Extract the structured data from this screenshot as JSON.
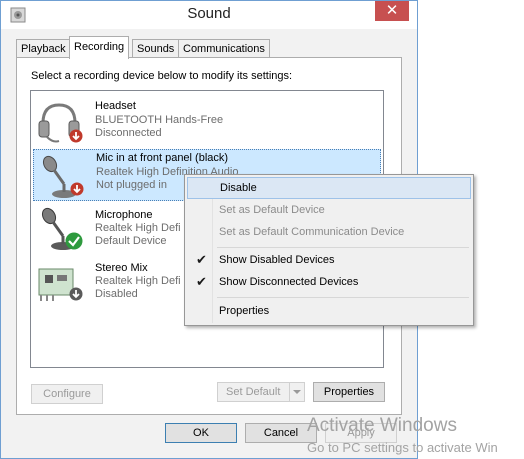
{
  "window": {
    "title": "Sound",
    "close_label": "✕"
  },
  "tabs": [
    {
      "label": "Playback",
      "active": false
    },
    {
      "label": "Recording",
      "active": true
    },
    {
      "label": "Sounds",
      "active": false
    },
    {
      "label": "Communications",
      "active": false
    }
  ],
  "instruction": "Select a recording device below to modify its settings:",
  "devices": [
    {
      "name": "Headset",
      "driver": "BLUETOOTH Hands-Free",
      "status": "Disconnected",
      "icon": "headset-icon",
      "badge": "down-arrow-red"
    },
    {
      "name": "Mic in at front panel (black)",
      "driver": "Realtek High Definition Audio",
      "status": "Not plugged in",
      "icon": "microphone-icon",
      "badge": "down-arrow-red",
      "selected": true
    },
    {
      "name": "Microphone",
      "driver": "Realtek High Defi",
      "status": "Default Device",
      "icon": "microphone-icon",
      "badge": "checkmark-green"
    },
    {
      "name": "Stereo Mix",
      "driver": "Realtek High Defi",
      "status": "Disabled",
      "icon": "sound-card-icon",
      "badge": "down-arrow-gray"
    }
  ],
  "buttons": {
    "configure": "Configure",
    "set_default": "Set Default",
    "properties": "Properties",
    "ok": "OK",
    "cancel": "Cancel",
    "apply": "Apply"
  },
  "context_menu": {
    "items": [
      {
        "label": "Disable",
        "checked": false,
        "disabled": false,
        "highlighted": true
      },
      {
        "label": "Set as Default Device",
        "checked": false,
        "disabled": true
      },
      {
        "label": "Set as Default Communication Device",
        "checked": false,
        "disabled": true
      },
      {
        "label": "Show Disabled Devices",
        "checked": true,
        "disabled": false
      },
      {
        "label": "Show Disconnected Devices",
        "checked": true,
        "disabled": false
      },
      {
        "label": "Properties",
        "checked": false,
        "disabled": false
      }
    ]
  },
  "watermark": {
    "title": "Activate Windows",
    "subtitle": "Go to PC settings to activate Win"
  },
  "colors": {
    "accent": "#3c7fb1",
    "selection": "#cce8ff",
    "close": "#c75050"
  }
}
